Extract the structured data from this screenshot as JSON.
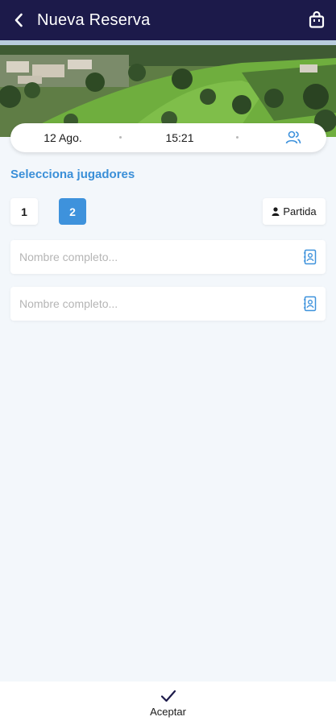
{
  "header": {
    "title": "Nueva Reserva",
    "back_icon": "chevron-left-icon",
    "bag_icon": "shopping-bag-icon",
    "bg_color": "#1c1a4a"
  },
  "booking": {
    "date": "12 Ago.",
    "time": "15:21",
    "players_icon": "users-icon"
  },
  "players": {
    "section_title": "Selecciona jugadores",
    "options": [
      "1",
      "2"
    ],
    "selected": "2",
    "partida_label": "Partida",
    "fields": [
      {
        "placeholder": "Nombre completo...",
        "value": ""
      },
      {
        "placeholder": "Nombre completo...",
        "value": ""
      }
    ]
  },
  "footer": {
    "accept_label": "Aceptar"
  },
  "colors": {
    "accent": "#3e92dc",
    "background": "#f3f7fb"
  }
}
